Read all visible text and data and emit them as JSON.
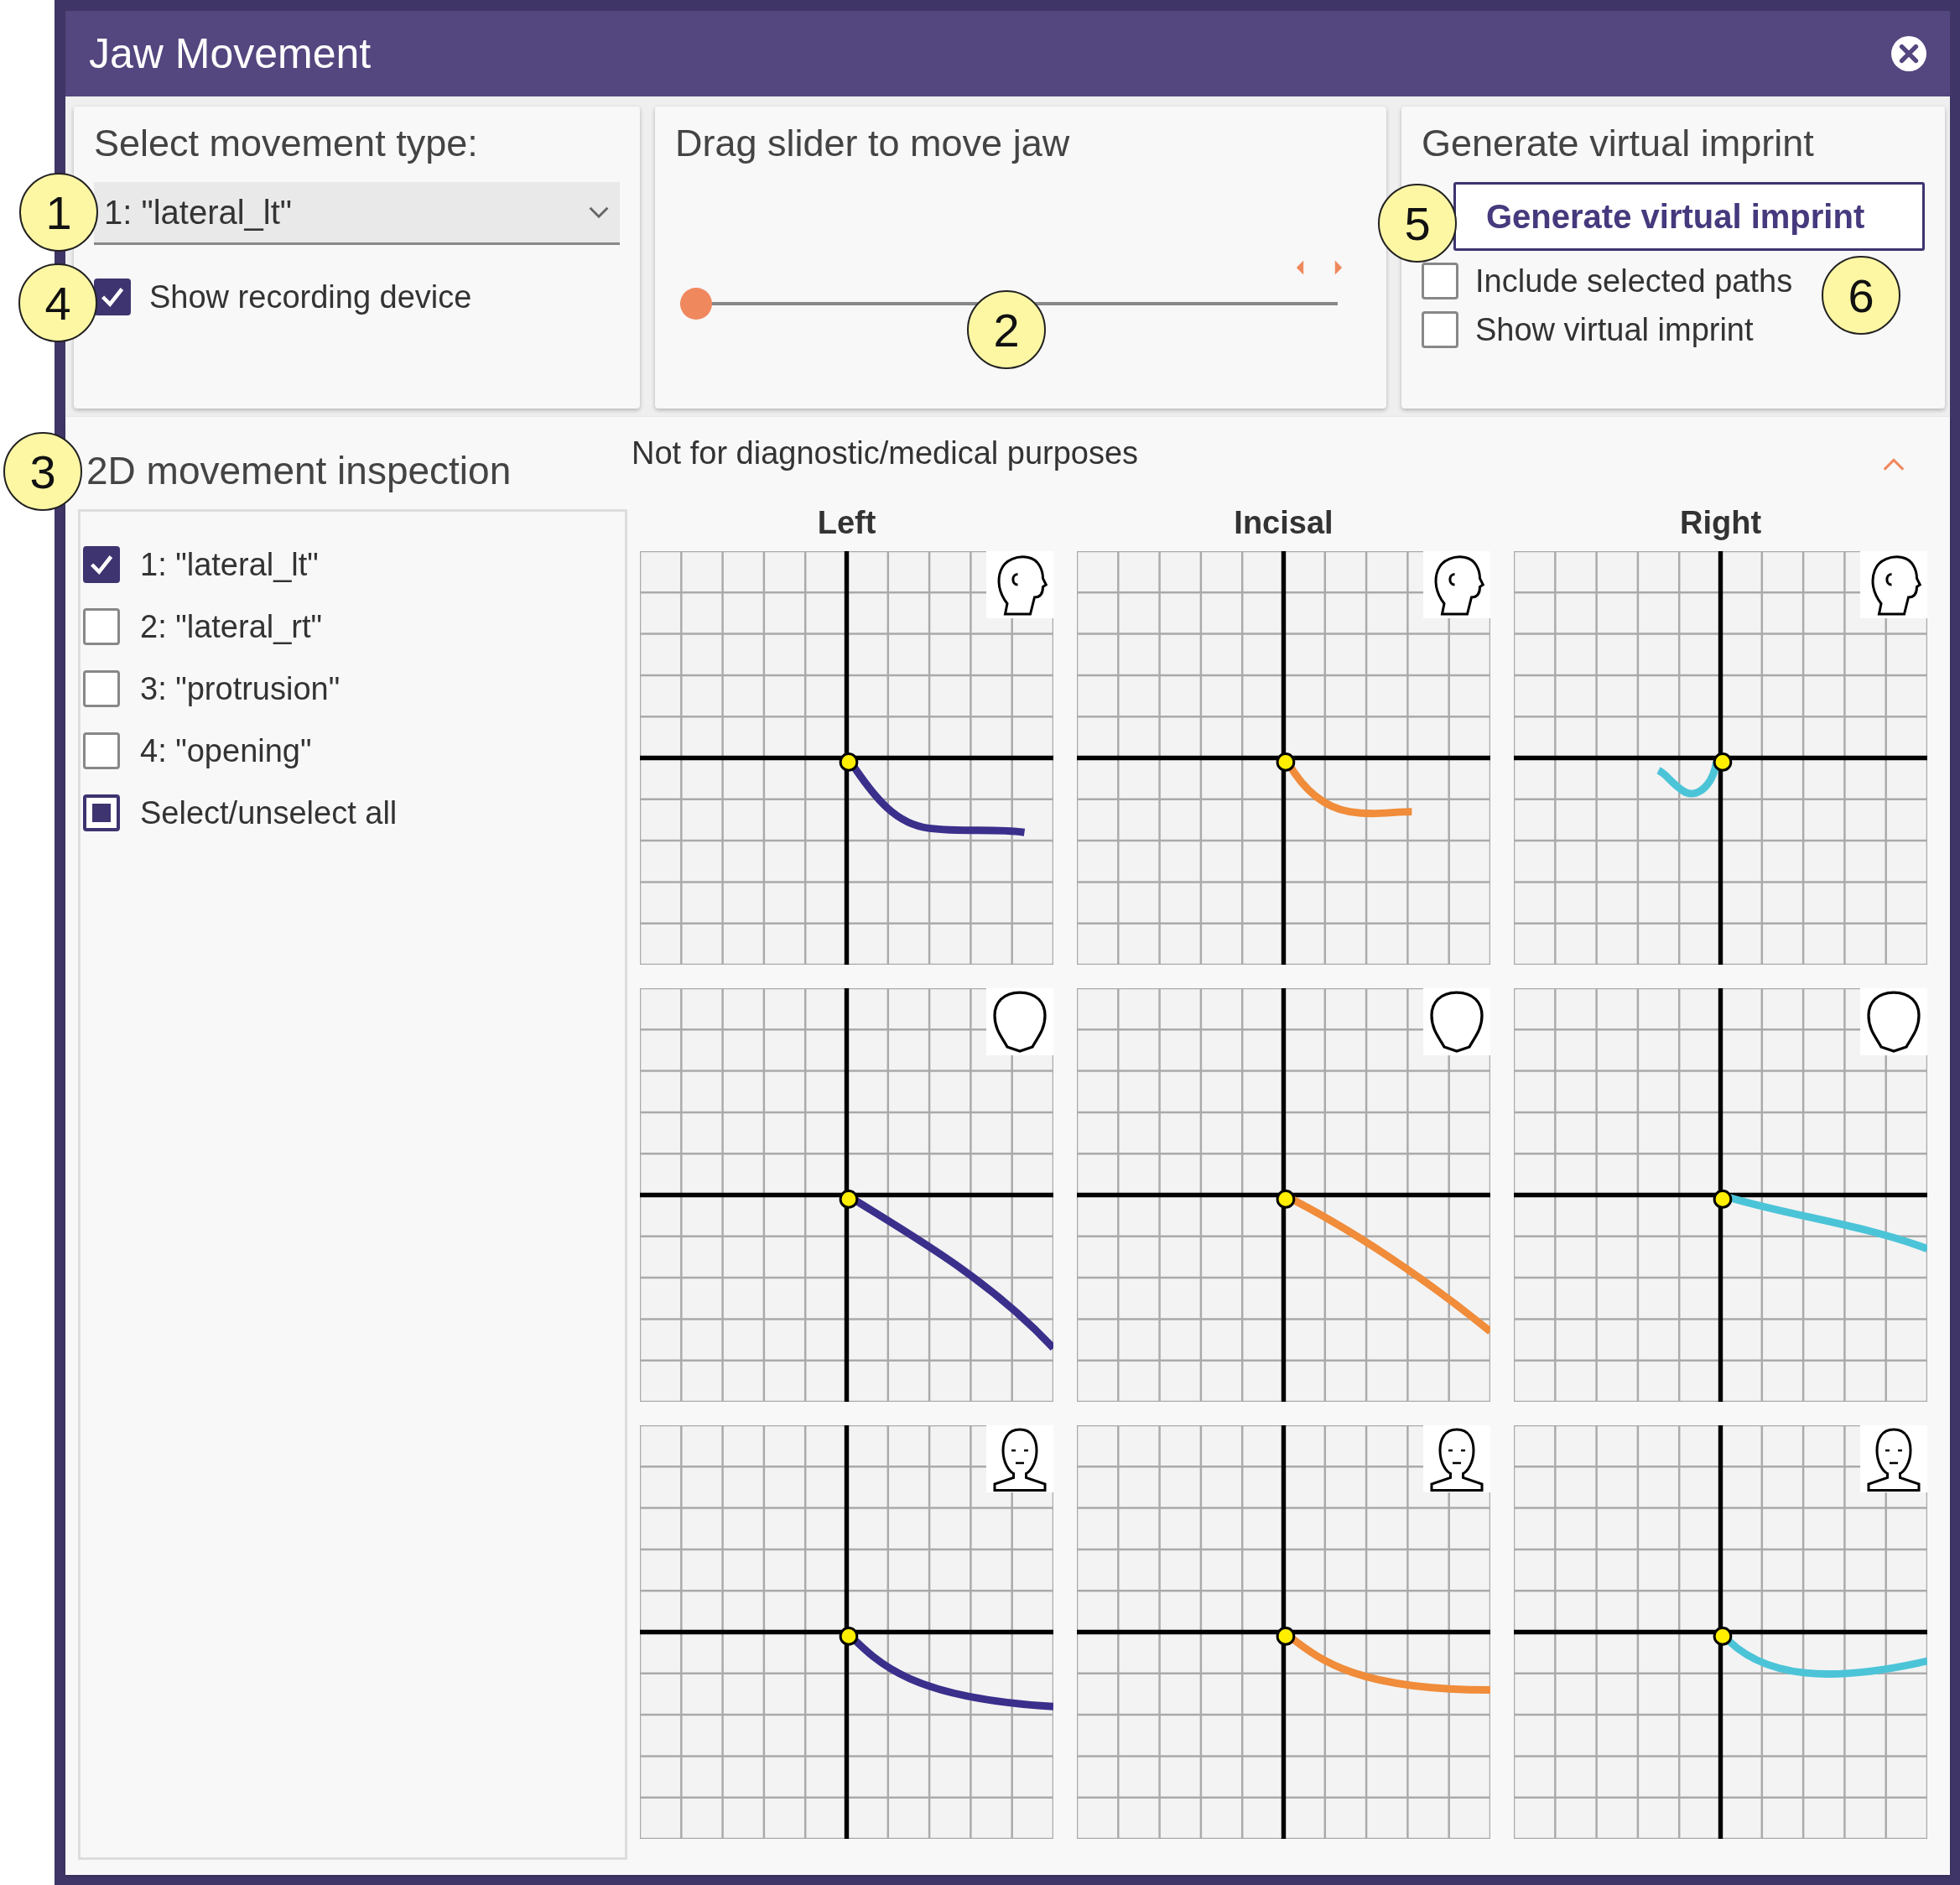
{
  "window": {
    "title": "Jaw Movement"
  },
  "movement_card": {
    "title": "Select movement type:",
    "dropdown": {
      "value": "1: \"lateral_lt\""
    },
    "checkbox": {
      "label": "Show recording device",
      "checked": true
    }
  },
  "slider_card": {
    "title": "Drag slider to move jaw",
    "slider": {
      "level": 0
    }
  },
  "imprint_card": {
    "title": "Generate virtual imprint",
    "button": "Generate virtual imprint",
    "checkboxes": [
      {
        "label": "Include selected paths",
        "checked": false
      },
      {
        "label": "Show virtual imprint",
        "checked": false
      }
    ]
  },
  "inspection": {
    "title": "2D movement inspection",
    "notice": "Not for diagnostic/medical purposes",
    "expanded": true,
    "list": [
      {
        "label": "1: \"lateral_lt\"",
        "checked": true,
        "partial": false
      },
      {
        "label": "2: \"lateral_rt\"",
        "checked": false,
        "partial": false
      },
      {
        "label": "3: \"protrusion\"",
        "checked": false,
        "partial": false
      },
      {
        "label": "4: \"opening\"",
        "checked": false,
        "partial": false
      },
      {
        "label": "Select/unselect all",
        "checked": false,
        "partial": true
      }
    ],
    "plot_columns": [
      {
        "label": "Left",
        "color": "#3b2f8c"
      },
      {
        "label": "Incisal",
        "color": "#f08c3a"
      },
      {
        "label": "Right",
        "color": "#4cc4d8"
      }
    ],
    "plot_rows": [
      {
        "kind": "side"
      },
      {
        "kind": "top"
      },
      {
        "kind": "front"
      }
    ]
  },
  "callouts": [
    "1",
    "2",
    "3",
    "4",
    "5",
    "6"
  ]
}
